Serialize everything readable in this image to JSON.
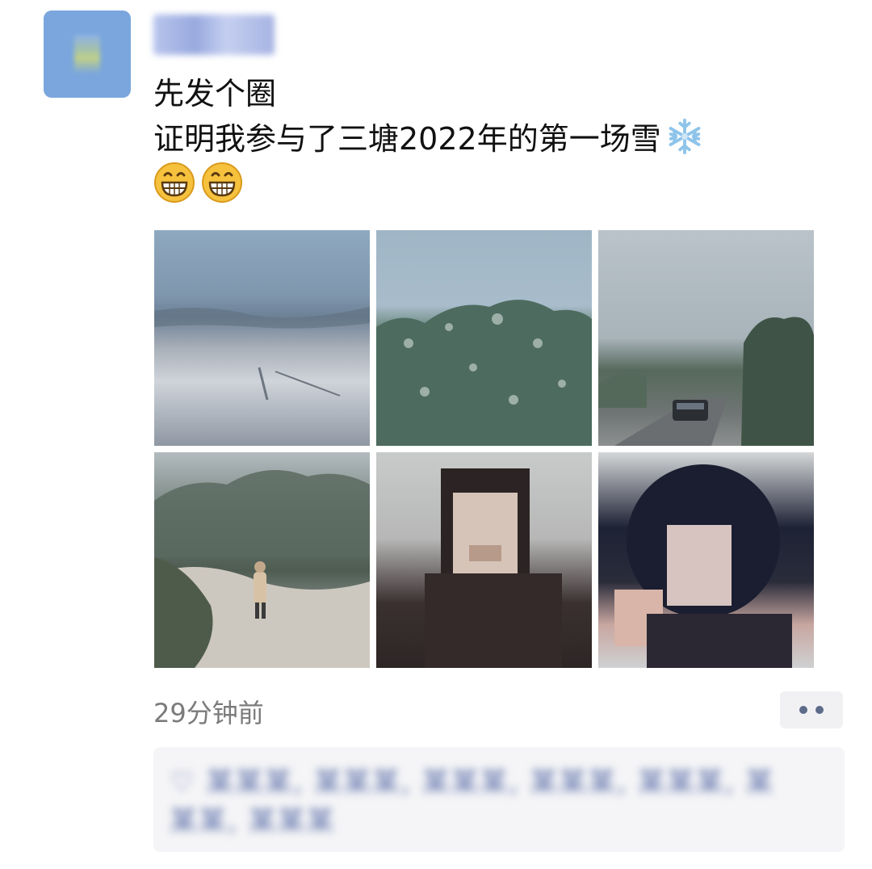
{
  "post": {
    "line1": "先发个圈",
    "line2": "证明我参与了三塘2022年的第一场雪",
    "snow_emoji": "snowflake-icon",
    "grin_emojis": [
      "grin-icon",
      "grin-icon"
    ]
  },
  "photos": [
    {
      "name": "snowy-field-photo"
    },
    {
      "name": "frosted-trees-photo"
    },
    {
      "name": "foggy-road-car-photo"
    },
    {
      "name": "person-in-snow-photo"
    },
    {
      "name": "selfie-blurred-photo"
    },
    {
      "name": "selfie-peace-sign-photo"
    }
  ],
  "footer": {
    "time": "29分钟前"
  },
  "likes": {
    "text": "♡ 某某某, 某某某, 某某某, 某某某, 某某某, 某某某, 某某某"
  },
  "colors": {
    "link_blue": "#5a6ea8",
    "meta_gray": "#7b7b7b",
    "avatar_bg": "#7aa6dd"
  }
}
